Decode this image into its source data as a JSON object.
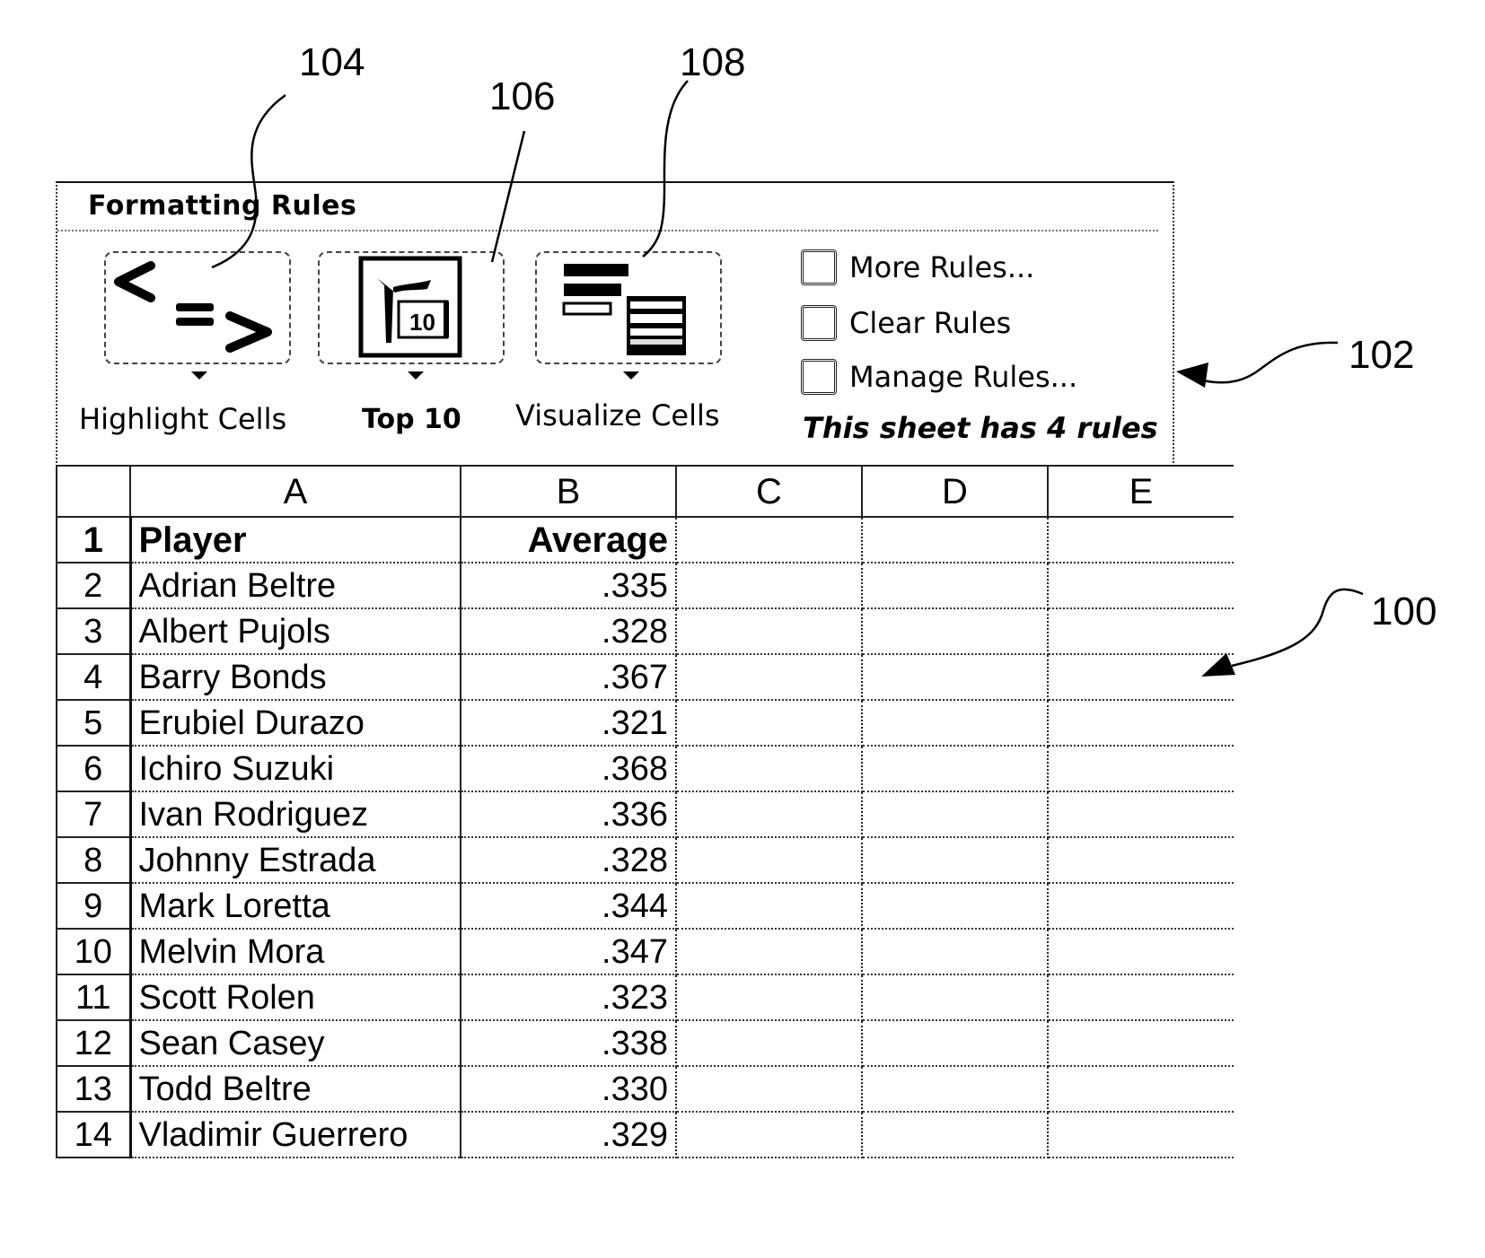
{
  "reference_numerals": {
    "spreadsheet": "100",
    "formatting_panel": "102",
    "highlight_cells": "104",
    "top_10": "106",
    "visualize_cells": "108"
  },
  "ribbon": {
    "title": "Formatting Rules",
    "galleries": [
      {
        "label": "Highlight Cells",
        "icon": "comparison-operators-icon"
      },
      {
        "label": "Top 10",
        "icon": "top-10-flag-icon"
      },
      {
        "label": "Visualize Cells",
        "icon": "data-bars-icon"
      }
    ],
    "commands": [
      {
        "label": "More Rules...",
        "icon": "more-rules-icon"
      },
      {
        "label": "Clear Rules",
        "icon": "clear-rules-icon"
      },
      {
        "label": "Manage Rules...",
        "icon": "manage-rules-icon"
      }
    ],
    "status": "This sheet has 4 rules"
  },
  "sheet": {
    "columns": [
      "A",
      "B",
      "C",
      "D",
      "E"
    ],
    "rows": [
      {
        "num": "1",
        "a": "Player",
        "b": "Average"
      },
      {
        "num": "2",
        "a": "Adrian Beltre",
        "b": ".335"
      },
      {
        "num": "3",
        "a": "Albert Pujols",
        "b": ".328"
      },
      {
        "num": "4",
        "a": "Barry Bonds",
        "b": ".367"
      },
      {
        "num": "5",
        "a": "Erubiel Durazo",
        "b": ".321"
      },
      {
        "num": "6",
        "a": "Ichiro Suzuki",
        "b": ".368"
      },
      {
        "num": "7",
        "a": "Ivan Rodriguez",
        "b": ".336"
      },
      {
        "num": "8",
        "a": "Johnny Estrada",
        "b": ".328"
      },
      {
        "num": "9",
        "a": "Mark Loretta",
        "b": ".344"
      },
      {
        "num": "10",
        "a": "Melvin Mora",
        "b": ".347"
      },
      {
        "num": "11",
        "a": "Scott Rolen",
        "b": ".323"
      },
      {
        "num": "12",
        "a": "Sean Casey",
        "b": ".338"
      },
      {
        "num": "13",
        "a": "Todd Beltre",
        "b": ".330"
      },
      {
        "num": "14",
        "a": "Vladimir Guerrero",
        "b": ".329"
      }
    ]
  },
  "icons": {
    "highlight_glyphs": [
      "<",
      "=",
      ">"
    ],
    "top10_badge": "10"
  }
}
